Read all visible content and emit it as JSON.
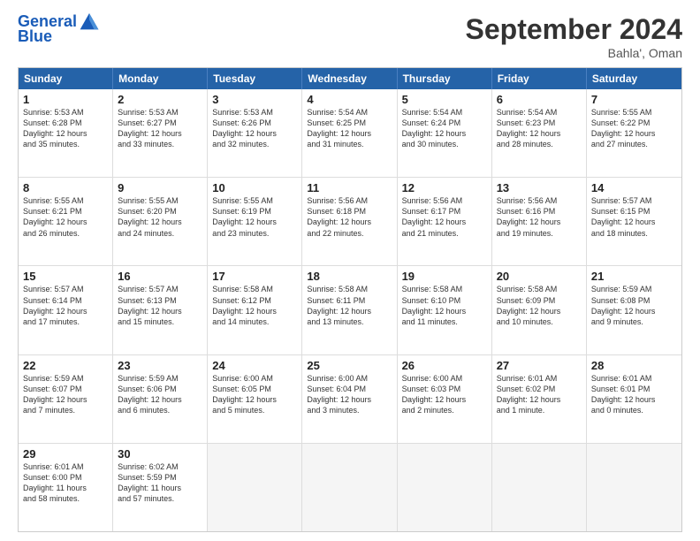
{
  "logo": {
    "line1": "General",
    "line2": "Blue"
  },
  "title": "September 2024",
  "location": "Bahla', Oman",
  "headers": [
    "Sunday",
    "Monday",
    "Tuesday",
    "Wednesday",
    "Thursday",
    "Friday",
    "Saturday"
  ],
  "weeks": [
    [
      {
        "day": "1",
        "text": "Sunrise: 5:53 AM\nSunset: 6:28 PM\nDaylight: 12 hours\nand 35 minutes."
      },
      {
        "day": "2",
        "text": "Sunrise: 5:53 AM\nSunset: 6:27 PM\nDaylight: 12 hours\nand 33 minutes."
      },
      {
        "day": "3",
        "text": "Sunrise: 5:53 AM\nSunset: 6:26 PM\nDaylight: 12 hours\nand 32 minutes."
      },
      {
        "day": "4",
        "text": "Sunrise: 5:54 AM\nSunset: 6:25 PM\nDaylight: 12 hours\nand 31 minutes."
      },
      {
        "day": "5",
        "text": "Sunrise: 5:54 AM\nSunset: 6:24 PM\nDaylight: 12 hours\nand 30 minutes."
      },
      {
        "day": "6",
        "text": "Sunrise: 5:54 AM\nSunset: 6:23 PM\nDaylight: 12 hours\nand 28 minutes."
      },
      {
        "day": "7",
        "text": "Sunrise: 5:55 AM\nSunset: 6:22 PM\nDaylight: 12 hours\nand 27 minutes."
      }
    ],
    [
      {
        "day": "8",
        "text": "Sunrise: 5:55 AM\nSunset: 6:21 PM\nDaylight: 12 hours\nand 26 minutes."
      },
      {
        "day": "9",
        "text": "Sunrise: 5:55 AM\nSunset: 6:20 PM\nDaylight: 12 hours\nand 24 minutes."
      },
      {
        "day": "10",
        "text": "Sunrise: 5:55 AM\nSunset: 6:19 PM\nDaylight: 12 hours\nand 23 minutes."
      },
      {
        "day": "11",
        "text": "Sunrise: 5:56 AM\nSunset: 6:18 PM\nDaylight: 12 hours\nand 22 minutes."
      },
      {
        "day": "12",
        "text": "Sunrise: 5:56 AM\nSunset: 6:17 PM\nDaylight: 12 hours\nand 21 minutes."
      },
      {
        "day": "13",
        "text": "Sunrise: 5:56 AM\nSunset: 6:16 PM\nDaylight: 12 hours\nand 19 minutes."
      },
      {
        "day": "14",
        "text": "Sunrise: 5:57 AM\nSunset: 6:15 PM\nDaylight: 12 hours\nand 18 minutes."
      }
    ],
    [
      {
        "day": "15",
        "text": "Sunrise: 5:57 AM\nSunset: 6:14 PM\nDaylight: 12 hours\nand 17 minutes."
      },
      {
        "day": "16",
        "text": "Sunrise: 5:57 AM\nSunset: 6:13 PM\nDaylight: 12 hours\nand 15 minutes."
      },
      {
        "day": "17",
        "text": "Sunrise: 5:58 AM\nSunset: 6:12 PM\nDaylight: 12 hours\nand 14 minutes."
      },
      {
        "day": "18",
        "text": "Sunrise: 5:58 AM\nSunset: 6:11 PM\nDaylight: 12 hours\nand 13 minutes."
      },
      {
        "day": "19",
        "text": "Sunrise: 5:58 AM\nSunset: 6:10 PM\nDaylight: 12 hours\nand 11 minutes."
      },
      {
        "day": "20",
        "text": "Sunrise: 5:58 AM\nSunset: 6:09 PM\nDaylight: 12 hours\nand 10 minutes."
      },
      {
        "day": "21",
        "text": "Sunrise: 5:59 AM\nSunset: 6:08 PM\nDaylight: 12 hours\nand 9 minutes."
      }
    ],
    [
      {
        "day": "22",
        "text": "Sunrise: 5:59 AM\nSunset: 6:07 PM\nDaylight: 12 hours\nand 7 minutes."
      },
      {
        "day": "23",
        "text": "Sunrise: 5:59 AM\nSunset: 6:06 PM\nDaylight: 12 hours\nand 6 minutes."
      },
      {
        "day": "24",
        "text": "Sunrise: 6:00 AM\nSunset: 6:05 PM\nDaylight: 12 hours\nand 5 minutes."
      },
      {
        "day": "25",
        "text": "Sunrise: 6:00 AM\nSunset: 6:04 PM\nDaylight: 12 hours\nand 3 minutes."
      },
      {
        "day": "26",
        "text": "Sunrise: 6:00 AM\nSunset: 6:03 PM\nDaylight: 12 hours\nand 2 minutes."
      },
      {
        "day": "27",
        "text": "Sunrise: 6:01 AM\nSunset: 6:02 PM\nDaylight: 12 hours\nand 1 minute."
      },
      {
        "day": "28",
        "text": "Sunrise: 6:01 AM\nSunset: 6:01 PM\nDaylight: 12 hours\nand 0 minutes."
      }
    ],
    [
      {
        "day": "29",
        "text": "Sunrise: 6:01 AM\nSunset: 6:00 PM\nDaylight: 11 hours\nand 58 minutes."
      },
      {
        "day": "30",
        "text": "Sunrise: 6:02 AM\nSunset: 5:59 PM\nDaylight: 11 hours\nand 57 minutes."
      },
      {
        "day": "",
        "text": ""
      },
      {
        "day": "",
        "text": ""
      },
      {
        "day": "",
        "text": ""
      },
      {
        "day": "",
        "text": ""
      },
      {
        "day": "",
        "text": ""
      }
    ]
  ]
}
